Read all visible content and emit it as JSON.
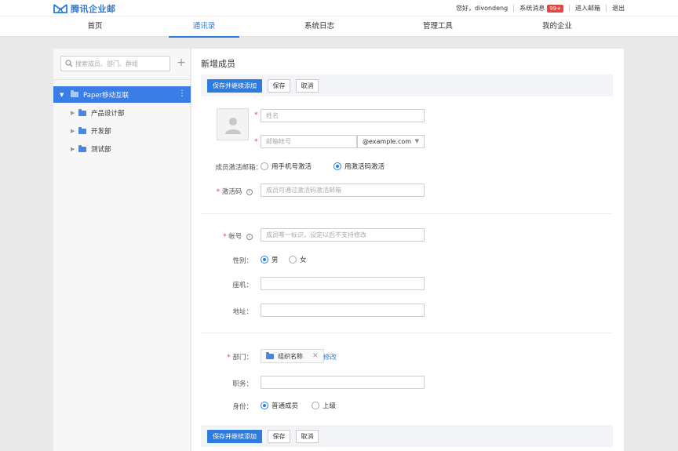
{
  "header": {
    "brand": "腾讯企业邮",
    "greeting": "您好，divondeng",
    "messages_label": "系统消息",
    "messages_badge": "99+",
    "enter_mail": "进入邮箱",
    "logout": "退出"
  },
  "nav": {
    "tabs": [
      {
        "label": "首页",
        "active": false
      },
      {
        "label": "通讯录",
        "active": true
      },
      {
        "label": "系统日志",
        "active": false
      },
      {
        "label": "管理工具",
        "active": false
      },
      {
        "label": "我的企业",
        "active": false
      }
    ]
  },
  "sidebar": {
    "search_placeholder": "搜索成员、部门、群组",
    "add_symbol": "+",
    "root": {
      "label": "Paper移动互联",
      "more": "⋮"
    },
    "items": [
      {
        "label": "产品设计部"
      },
      {
        "label": "开发部"
      },
      {
        "label": "测试部"
      }
    ]
  },
  "form": {
    "title": "新增成员",
    "buttons": {
      "save_continue": "保存并继续添加",
      "save": "保存",
      "cancel": "取消"
    },
    "name_placeholder": "姓名",
    "email_placeholder": "邮箱帐号",
    "email_domain": "@example.com",
    "activation_label": "成员激活邮箱：",
    "activation_options": [
      "用手机号激活",
      "用激活码激活"
    ],
    "activation_selected": 1,
    "code_label": "激活码",
    "code_placeholder": "成员可通过激活码激活邮箱",
    "account_label": "帐号",
    "account_placeholder": "成员唯一标识，设定以后不支持修改",
    "gender_label": "性别：",
    "gender_options": [
      "男",
      "女"
    ],
    "phone_label": "座机：",
    "address_label": "地址：",
    "dept_label": "部门：",
    "dept_value": "组织名称",
    "dept_modify": "修改",
    "position_label": "职务：",
    "identity_label": "身份：",
    "identity_options": [
      "普通成员",
      "上级"
    ]
  },
  "colors": {
    "accent": "#2e7be0",
    "badge": "#e5463f"
  }
}
